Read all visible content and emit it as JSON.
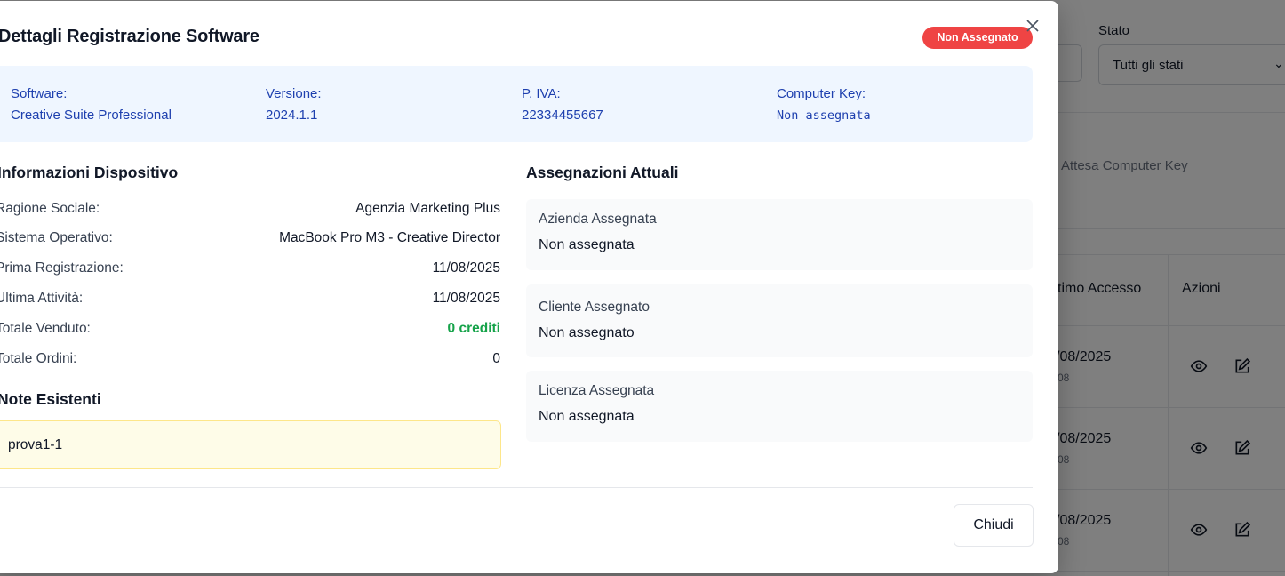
{
  "background": {
    "filter_label": "Stato",
    "filter_value": "Tutti gli stati",
    "card_text": "Attesa Computer Key",
    "table_headers": [
      "timo Accesso",
      "Azioni"
    ],
    "rows": [
      {
        "date": "/08/2025",
        "sub": "08"
      },
      {
        "date": "/08/2025",
        "sub": "08"
      },
      {
        "date": "/08/2025",
        "sub": "08"
      }
    ]
  },
  "modal": {
    "title": "Dettagli Registrazione Software",
    "status_badge": "Non Assegnato",
    "status_color": "#ef4444",
    "info": {
      "software_label": "Software:",
      "software_value": "Creative Suite Professional",
      "version_label": "Versione:",
      "version_value": "2024.1.1",
      "piva_label": "P. IVA:",
      "piva_value": "22334455667",
      "computer_key_label": "Computer Key:",
      "computer_key_value": "Non assegnata"
    },
    "device_section": {
      "title": "Informazioni Dispositivo",
      "rows": [
        {
          "key": "Ragione Sociale:",
          "value": "Agenzia Marketing Plus"
        },
        {
          "key": "Sistema Operativo:",
          "value": "MacBook Pro M3 - Creative Director"
        },
        {
          "key": "Prima Registrazione:",
          "value": "11/08/2025"
        },
        {
          "key": "Ultima Attività:",
          "value": "11/08/2025"
        },
        {
          "key": "Totale Venduto:",
          "value": "0 crediti"
        },
        {
          "key": "Totale Ordini:",
          "value": "0"
        }
      ]
    },
    "notes_section": {
      "title": "Note Esistenti",
      "note": "prova1-1"
    },
    "assignments_section": {
      "title": "Assegnazioni Attuali",
      "cards": [
        {
          "label": "Azienda Assegnata",
          "value": "Non assegnata"
        },
        {
          "label": "Cliente Assegnato",
          "value": "Non assegnato"
        },
        {
          "label": "Licenza Assegnata",
          "value": "Non assegnata"
        }
      ]
    },
    "footer": {
      "close_label": "Chiudi"
    },
    "icons": {
      "close": "close-icon",
      "view": "eye-icon",
      "edit": "edit-icon"
    }
  }
}
